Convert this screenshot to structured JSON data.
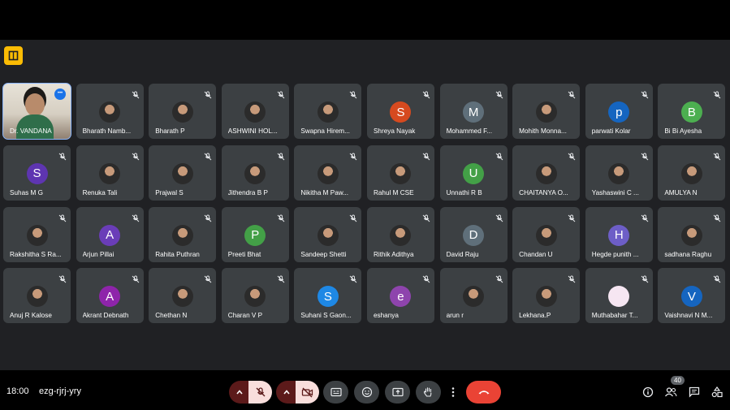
{
  "meeting": {
    "time": "18:00",
    "code": "ezg-rjrj-yry",
    "participant_count": "40"
  },
  "colors": {
    "stage_bg": "#202124",
    "tile_bg": "#3c4043",
    "hangup": "#ea4335",
    "badge": "#fbbc04"
  },
  "participants": [
    {
      "name": "Dr. VANDANA",
      "type": "self-video"
    },
    {
      "name": "Bharath Namb...",
      "type": "photo"
    },
    {
      "name": "Bharath P",
      "type": "photo"
    },
    {
      "name": "ASHWINI HOL...",
      "type": "photo"
    },
    {
      "name": "Swapna Hirem...",
      "type": "photo"
    },
    {
      "name": "Shreya Nayak",
      "type": "letter",
      "initial": "S",
      "color": "#d64a1f"
    },
    {
      "name": "Mohammed F...",
      "type": "letter",
      "initial": "M",
      "color": "#5f6f7a"
    },
    {
      "name": "Mohith Monna...",
      "type": "photo"
    },
    {
      "name": "parwati Kolar",
      "type": "letter",
      "initial": "p",
      "color": "#1565c0"
    },
    {
      "name": "Bi Bi Ayesha",
      "type": "letter",
      "initial": "B",
      "color": "#4caf50"
    },
    {
      "name": "Suhas M G",
      "type": "letter",
      "initial": "S",
      "color": "#5e35b1"
    },
    {
      "name": "Renuka Tali",
      "type": "photo"
    },
    {
      "name": "Prajwal S",
      "type": "photo"
    },
    {
      "name": "Jithendra B P",
      "type": "photo"
    },
    {
      "name": "Nikitha M Paw...",
      "type": "photo"
    },
    {
      "name": "Rahul M CSE",
      "type": "photo"
    },
    {
      "name": "Unnathi R B",
      "type": "letter",
      "initial": "U",
      "color": "#43a047"
    },
    {
      "name": "CHAITANYA O...",
      "type": "photo"
    },
    {
      "name": "Yashaswini C ...",
      "type": "photo"
    },
    {
      "name": "AMULYA N",
      "type": "photo"
    },
    {
      "name": "Rakshitha S Ra...",
      "type": "photo"
    },
    {
      "name": "Arjun Pillai",
      "type": "letter",
      "initial": "A",
      "color": "#6a3db8"
    },
    {
      "name": "Rahita Puthran",
      "type": "photo"
    },
    {
      "name": "Preeti Bhat",
      "type": "letter",
      "initial": "P",
      "color": "#43a047"
    },
    {
      "name": "Sandeep Shetti",
      "type": "photo"
    },
    {
      "name": "Rithik Adithya",
      "type": "photo"
    },
    {
      "name": "David Raju",
      "type": "letter",
      "initial": "D",
      "color": "#5f6f7a"
    },
    {
      "name": "Chandan U",
      "type": "photo"
    },
    {
      "name": "Hegde punith ...",
      "type": "letter",
      "initial": "H",
      "color": "#6d5ec7"
    },
    {
      "name": "sadhana Raghu",
      "type": "photo"
    },
    {
      "name": "Anuj R Kalose",
      "type": "photo"
    },
    {
      "name": "Akrant Debnath",
      "type": "letter",
      "initial": "A",
      "color": "#8e24aa"
    },
    {
      "name": "Chethan N",
      "type": "photo"
    },
    {
      "name": "Charan V P",
      "type": "photo"
    },
    {
      "name": "Suhani S Gaon...",
      "type": "letter",
      "initial": "S",
      "color": "#1e88e5"
    },
    {
      "name": "eshanya",
      "type": "letter",
      "initial": "e",
      "color": "#8e44ad"
    },
    {
      "name": "arun r",
      "type": "photo"
    },
    {
      "name": "Lekhana.P",
      "type": "photo"
    },
    {
      "name": "Muthabahar T...",
      "type": "letter",
      "initial": "",
      "color": "#f6e6f2"
    },
    {
      "name": "Vaishnavi N M...",
      "type": "letter",
      "initial": "V",
      "color": "#1565c0"
    }
  ]
}
